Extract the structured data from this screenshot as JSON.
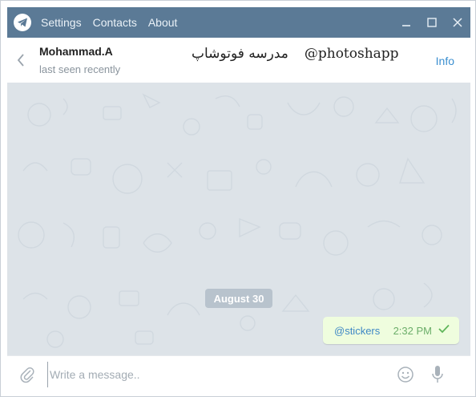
{
  "titlebar": {
    "menu": [
      "Settings",
      "Contacts",
      "About"
    ],
    "logo_icon": "telegram-plane-icon",
    "controls": [
      "minimize-icon",
      "maximize-icon",
      "close-icon"
    ]
  },
  "chat_header": {
    "peer_name": "Mohammad.A",
    "peer_status": "last seen recently",
    "center_title_arabic": "مدرسه فوتوشاپ",
    "center_title_handle": "@photoshapp",
    "info_label": "Info"
  },
  "chat": {
    "date_badge": "August 30",
    "message": {
      "text": "@stickers",
      "time": "2:32 PM",
      "status_icon": "check-icon"
    },
    "colors": {
      "background": "#dde3e8",
      "bubble": "#effdde",
      "link": "#3f88c5"
    }
  },
  "composer": {
    "placeholder": "Write a message..",
    "value": ""
  },
  "colors": {
    "titlebar": "#5b7a96",
    "accent": "#3b8fd0"
  }
}
